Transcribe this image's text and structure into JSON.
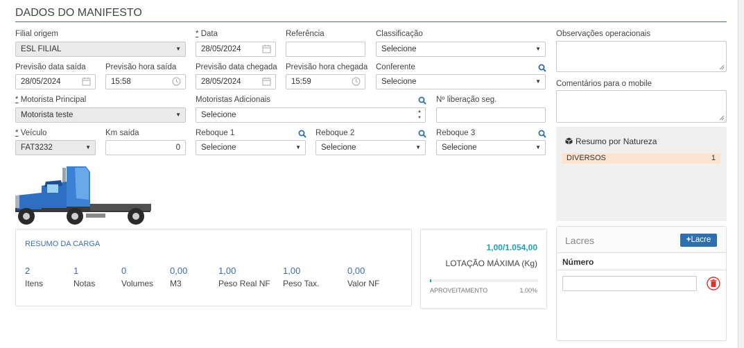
{
  "page": {
    "title": "DADOS DO MANIFESTO"
  },
  "fields": {
    "filial_origem": {
      "label": "Filial origem",
      "value": "ESL FILIAL"
    },
    "data": {
      "label": "Data",
      "required_mark": "*",
      "value": "28/05/2024"
    },
    "referencia": {
      "label": "Referência",
      "value": ""
    },
    "classificacao": {
      "label": "Classificação",
      "value": "Selecione"
    },
    "obs_operacionais": {
      "label": "Observações operacionais",
      "value": ""
    },
    "prev_data_saida": {
      "label": "Previsão data saída",
      "value": "28/05/2024"
    },
    "prev_hora_saida": {
      "label": "Previsão hora saída",
      "value": "15:58"
    },
    "prev_data_chegada": {
      "label": "Previsão data chegada",
      "value": "28/05/2024"
    },
    "prev_hora_chegada": {
      "label": "Previsão hora chegada",
      "value": "15:59"
    },
    "conferente": {
      "label": "Conferente",
      "value": "Selecione"
    },
    "comentarios_mobile": {
      "label": "Comentários para o mobile",
      "value": ""
    },
    "motorista_principal": {
      "label": "Motorista Principal",
      "required_mark": "*",
      "value": "Motorista teste"
    },
    "motoristas_adicionais": {
      "label": "Motoristas Adicionais",
      "value": "Selecione"
    },
    "liberacao_seg": {
      "label": "Nº liberação seg.",
      "value": ""
    },
    "veiculo": {
      "label": "Veículo",
      "required_mark": "*",
      "value": "FAT3232"
    },
    "km_saida": {
      "label": "Km saída",
      "value": "0"
    },
    "reboque1": {
      "label": "Reboque 1",
      "value": "Selecione"
    },
    "reboque2": {
      "label": "Reboque 2",
      "value": "Selecione"
    },
    "reboque3": {
      "label": "Reboque 3",
      "value": "Selecione"
    }
  },
  "natureza": {
    "title": "Resumo por Natureza",
    "rows": [
      {
        "name": "DIVERSOS",
        "count": "1"
      }
    ]
  },
  "resumo_carga": {
    "title": "RESUMO DA CARGA",
    "items": [
      {
        "value": "2",
        "caption": "Itens"
      },
      {
        "value": "1",
        "caption": "Notas"
      },
      {
        "value": "0",
        "caption": "Volumes"
      },
      {
        "value": "0,00",
        "caption": "M3"
      },
      {
        "value": "1,00",
        "caption": "Peso Real NF"
      },
      {
        "value": "1,00",
        "caption": "Peso Tax."
      },
      {
        "value": "0,00",
        "caption": "Valor NF"
      }
    ]
  },
  "lotacao": {
    "value": "1,00/1.054,00",
    "caption": "LOTAÇÃO MÁXIMA (Kg)",
    "aproveitamento_label": "APROVEITAMENTO",
    "aproveitamento_pct": "1.00%",
    "progress_fraction": 0.01
  },
  "lacres": {
    "title": "Lacres",
    "add_button": "Lacre",
    "column": "Número",
    "input_value": ""
  },
  "colors": {
    "accent": "#3a6ea5",
    "teal": "#1fa0b4",
    "natureza_row": "#fbe3cf",
    "button": "#2e6fb0",
    "delete": "#d9332b"
  }
}
